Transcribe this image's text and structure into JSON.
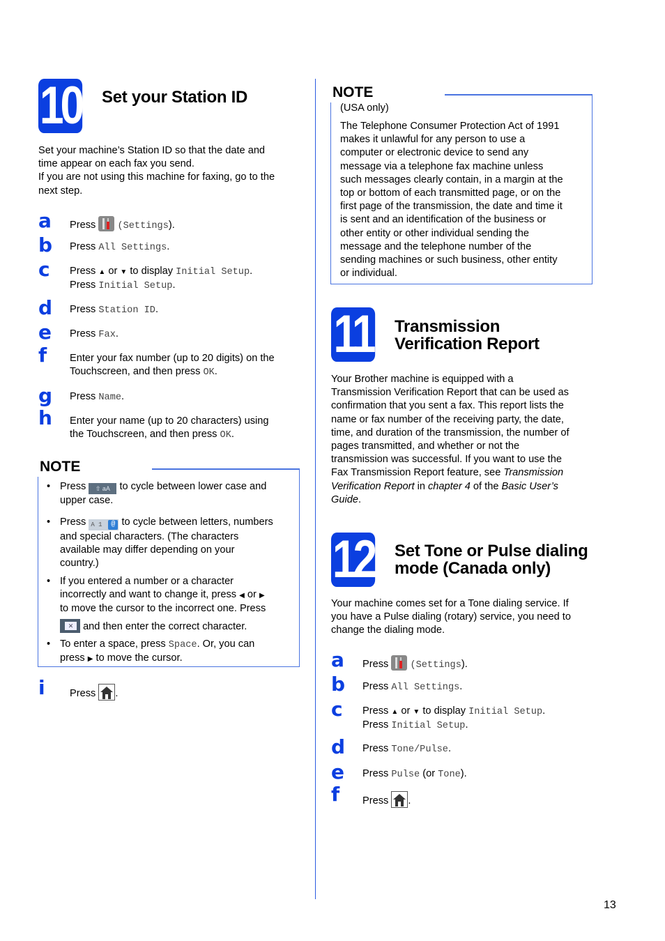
{
  "page_number": "13",
  "colors": {
    "accent": "#0b3fe0",
    "note_border": "#4a74e0"
  },
  "step10": {
    "number": "10",
    "title": "Set your Station ID",
    "intro": [
      "Set your machine’s Station ID so that the date and",
      "time appear on each fax you send.",
      "If you are not using this machine for faxing, go to the",
      "next step."
    ],
    "steps": {
      "a": {
        "letter": "a",
        "prefix": "Press",
        "icon": "settings-icon",
        "code": "(Settings",
        "suffix": ")."
      },
      "b": {
        "letter": "b",
        "prefix": "Press",
        "code": "All Settings",
        "suffix": "."
      },
      "c": {
        "letter": "c",
        "prefix": "Press",
        "up": "▲",
        "or": "or",
        "down": "▼",
        "mid": "to display",
        "code": "Initial Setup",
        "suffix": ".",
        "line2_prefix": "Press",
        "line2_code": "Initial Setup",
        "line2_suffix": "."
      },
      "d": {
        "letter": "d",
        "prefix": "Press",
        "code": "Station ID",
        "suffix": "."
      },
      "e": {
        "letter": "e",
        "prefix": "Press",
        "code": "Fax",
        "suffix": "."
      },
      "f": {
        "letter": "f",
        "line1": "Enter your fax number (up to 20 digits) on the",
        "line2": "Touchscreen, and then press",
        "code": "OK",
        "suffix": "."
      },
      "g": {
        "letter": "g",
        "prefix": "Press",
        "code": "Name",
        "suffix": "."
      },
      "h": {
        "letter": "h",
        "line1": "Enter your name (up to 20 characters) using",
        "line2": "the Touchscreen, and then press",
        "code": "OK",
        "suffix": "."
      },
      "i": {
        "letter": "i",
        "prefix": "Press",
        "icon": "home-icon",
        "suffix": "."
      }
    },
    "note": {
      "title": "NOTE",
      "bullet1": {
        "prefix": "Press",
        "icon_label": "⇧ aA",
        "line1_rest": "to cycle between lower case and",
        "line2": "upper case."
      },
      "bullet2": {
        "prefix": "Press",
        "icon_label": "A 1",
        "icon_at": "@",
        "line1_rest": "to cycle between letters, numbers",
        "lines": [
          "and special characters. (The characters",
          "available may differ depending on your",
          "country.)"
        ]
      },
      "bullet3": {
        "line1": "If you entered a number or a character",
        "line2_a": "incorrectly and want to change it, press",
        "left": "◀",
        "or": "or",
        "right": "▶",
        "line3": "to move the cursor to the incorrect one. Press",
        "icon_label": "✕",
        "line4": "and then enter the correct character."
      },
      "bullet4": {
        "prefix": "To enter a space, press",
        "code": "Space",
        "rest": ". Or, you can",
        "line2_a": "press",
        "right": "▶",
        "line2_b": "to move the cursor."
      },
      "bullet_char": "•"
    }
  },
  "usa_note": {
    "title": "NOTE",
    "subtitle": "(USA only)",
    "lines": [
      "The Telephone Consumer Protection Act of 1991",
      "makes it unlawful for any person to use a",
      "computer or electronic device to send any",
      "message via a telephone fax machine unless",
      "such messages clearly contain, in a margin at the",
      "top or bottom of each transmitted page, or on the",
      "first page of the transmission, the date and time it",
      "is sent and an identification of the business or",
      "other entity or other individual sending the",
      "message and the telephone number of the",
      "sending machines or such business, other entity",
      "or individual."
    ]
  },
  "step11": {
    "number": "11",
    "title_line1": "Transmission",
    "title_line2": "Verification Report",
    "lines": [
      "Your Brother machine is equipped with a",
      "Transmission Verification Report that can be used as",
      "confirmation that you sent a fax. This report lists the",
      "name or fax number of the receiving party, the date,",
      "time, and duration of the transmission, the number of",
      "pages transmitted, and whether or not the",
      "transmission was successful. If you want to use the"
    ],
    "line8_a": "Fax Transmission Report feature, see",
    "line8_i": "Transmission",
    "line9_i1": "Verification Report",
    "line9_b": "in",
    "line9_i2": "chapter 4",
    "line9_c": "of the",
    "line9_i3": "Basic User’s",
    "line10_i": "Guide",
    "line10_b": "."
  },
  "step12": {
    "number": "12",
    "title_line1": "Set Tone or Pulse dialing",
    "title_line2": "mode (Canada only)",
    "intro": [
      "Your machine comes set for a Tone dialing service. If",
      "you have a Pulse dialing (rotary) service, you need to",
      "change the dialing mode."
    ],
    "steps": {
      "a": {
        "letter": "a",
        "prefix": "Press",
        "code": "(Settings",
        "suffix": ")."
      },
      "b": {
        "letter": "b",
        "prefix": "Press",
        "code": "All Settings",
        "suffix": "."
      },
      "c": {
        "letter": "c",
        "prefix": "Press",
        "up": "▲",
        "or": "or",
        "down": "▼",
        "mid": "to display",
        "code": "Initial Setup",
        "suffix": ".",
        "line2_prefix": "Press",
        "line2_code": "Initial Setup",
        "line2_suffix": "."
      },
      "d": {
        "letter": "d",
        "prefix": "Press",
        "code": "Tone/Pulse",
        "suffix": "."
      },
      "e": {
        "letter": "e",
        "prefix": "Press",
        "code": "Pulse",
        "mid": "(or",
        "code2": "Tone",
        "suffix": ")."
      },
      "f": {
        "letter": "f",
        "prefix": "Press",
        "suffix": "."
      }
    }
  }
}
